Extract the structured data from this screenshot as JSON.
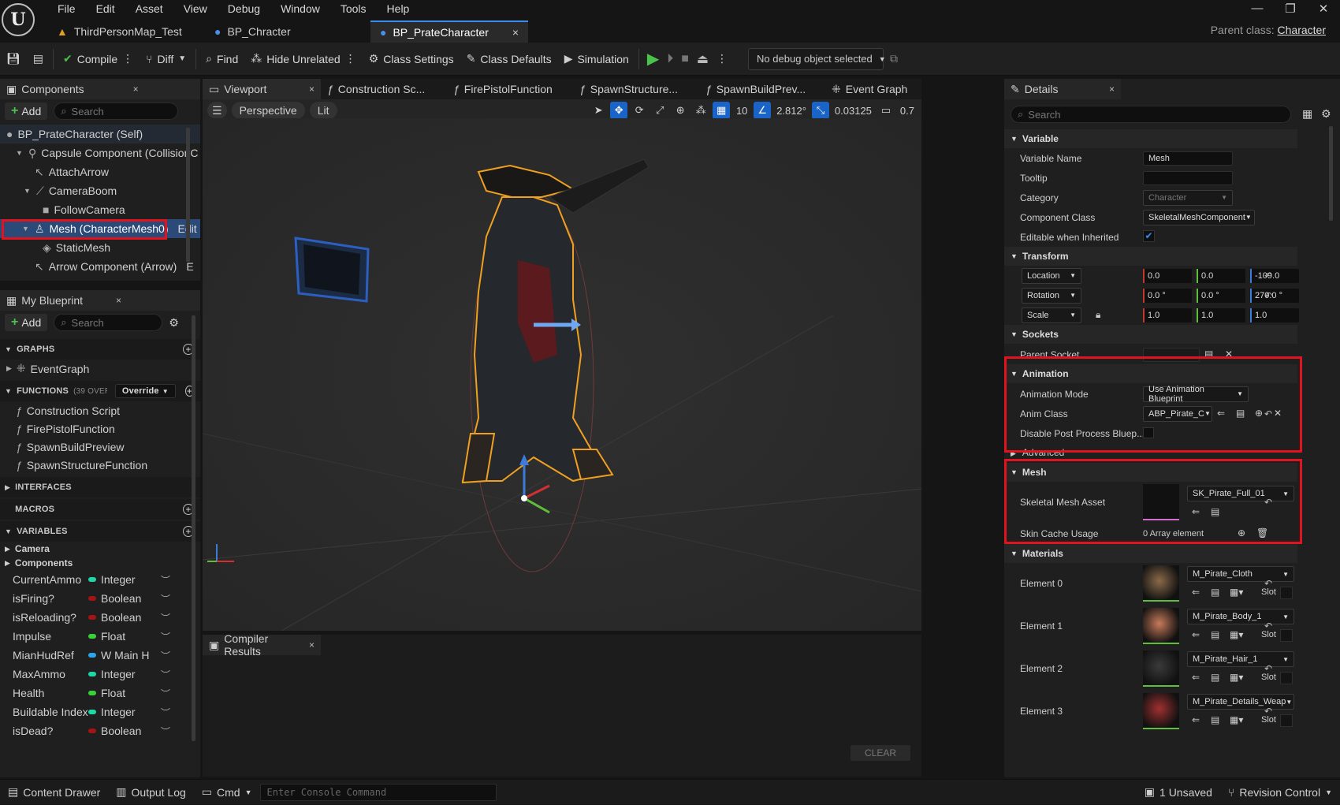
{
  "menu": [
    "File",
    "Edit",
    "Asset",
    "View",
    "Debug",
    "Window",
    "Tools",
    "Help"
  ],
  "window_controls": {
    "minimize": "—",
    "restore": "❐",
    "close": "✕"
  },
  "doc_tabs": [
    {
      "label": "ThirdPersonMap_Test",
      "icon": "map-icon"
    },
    {
      "label": "BP_Chracter",
      "icon": "person-icon"
    },
    {
      "label": "BP_PrateCharacter",
      "icon": "person-icon",
      "close": "×"
    }
  ],
  "parent_class": {
    "label": "Parent class:",
    "value": "Character"
  },
  "toolbar": {
    "compile": "Compile",
    "diff": "Diff",
    "find": "Find",
    "hide_unrelated": "Hide Unrelated",
    "class_settings": "Class Settings",
    "class_defaults": "Class Defaults",
    "simulation": "Simulation",
    "debug_object": "No debug object selected"
  },
  "components": {
    "tab": "Components",
    "add": "Add",
    "search_placeholder": "Search",
    "items": [
      {
        "label": "BP_PrateCharacter (Self)"
      },
      {
        "label": "Capsule Component (CollisionC"
      },
      {
        "label": "AttachArrow"
      },
      {
        "label": "CameraBoom"
      },
      {
        "label": "FollowCamera"
      },
      {
        "label": "Mesh (CharacterMesh0)",
        "suffix": "Edit"
      },
      {
        "label": "StaticMesh"
      },
      {
        "label": "Arrow Component (Arrow)",
        "suffix": "E"
      }
    ]
  },
  "my_blueprint": {
    "tab": "My Blueprint",
    "add": "Add",
    "search_placeholder": "Search",
    "graphs_header": "GRAPHS",
    "graphs": [
      "EventGraph"
    ],
    "functions_header": "FUNCTIONS",
    "functions_count": "(39 OVERRI",
    "override": "Override",
    "functions": [
      "Construction Script",
      "FirePistolFunction",
      "SpawnBuildPreview",
      "SpawnStructureFunction"
    ],
    "interfaces_header": "INTERFACES",
    "macros_header": "MACROS",
    "variables_header": "VARIABLES",
    "var_groups": [
      "Camera",
      "Components"
    ],
    "variables": [
      {
        "name": "CurrentAmmo",
        "type": "Integer",
        "color": "#1fd6a6"
      },
      {
        "name": "isFiring?",
        "type": "Boolean",
        "color": "#a31414"
      },
      {
        "name": "isReloading?",
        "type": "Boolean",
        "color": "#a31414"
      },
      {
        "name": "Impulse",
        "type": "Float",
        "color": "#38d13a"
      },
      {
        "name": "MianHudRef",
        "type": "W Main H",
        "color": "#2aa6e8"
      },
      {
        "name": "MaxAmmo",
        "type": "Integer",
        "color": "#1fd6a6"
      },
      {
        "name": "Health",
        "type": "Float",
        "color": "#38d13a"
      },
      {
        "name": "Buildable Index",
        "type": "Integer",
        "color": "#1fd6a6"
      },
      {
        "name": "isDead?",
        "type": "Boolean",
        "color": "#a31414"
      }
    ]
  },
  "editor_tabs": [
    {
      "label": "Viewport",
      "close": "×"
    },
    {
      "label": "Construction Sc..."
    },
    {
      "label": "FirePistolFunction"
    },
    {
      "label": "SpawnStructure..."
    },
    {
      "label": "SpawnBuildPrev..."
    },
    {
      "label": "Event Graph"
    }
  ],
  "viewport": {
    "perspective": "Perspective",
    "lit": "Lit",
    "grid_snap": "10",
    "rot_snap": "2.812°",
    "scale_snap": "0.03125",
    "cam_speed": "0.7"
  },
  "compiler": {
    "tab": "Compiler Results",
    "clear": "CLEAR"
  },
  "details": {
    "tab": "Details",
    "search_placeholder": "Search",
    "variable": {
      "header": "Variable",
      "variable_name_label": "Variable Name",
      "variable_name": "Mesh",
      "tooltip_label": "Tooltip",
      "category_label": "Category",
      "category": "Character",
      "component_class_label": "Component Class",
      "component_class": "SkeletalMeshComponent",
      "editable_label": "Editable when Inherited"
    },
    "transform": {
      "header": "Transform",
      "location_label": "Location",
      "location": [
        "0.0",
        "0.0",
        "-109.0"
      ],
      "rotation_label": "Rotation",
      "rotation": [
        "0.0 °",
        "0.0 °",
        "270.0 °"
      ],
      "scale_label": "Scale",
      "scale": [
        "1.0",
        "1.0",
        "1.0"
      ]
    },
    "sockets": {
      "header": "Sockets",
      "parent_socket_label": "Parent Socket"
    },
    "animation": {
      "header": "Animation",
      "mode_label": "Animation Mode",
      "mode": "Use Animation Blueprint",
      "class_label": "Anim Class",
      "class": "ABP_Pirate_C",
      "disable_label": "Disable Post Process Bluep...",
      "advanced": "Advanced"
    },
    "mesh": {
      "header": "Mesh",
      "asset_label": "Skeletal Mesh Asset",
      "asset": "SK_Pirate_Full_01",
      "skin_label": "Skin Cache Usage",
      "skin": "0 Array element"
    },
    "materials": {
      "header": "Materials",
      "slot": "Slot",
      "elements": [
        {
          "label": "Element 0",
          "value": "M_Pirate_Cloth"
        },
        {
          "label": "Element 1",
          "value": "M_Pirate_Body_1"
        },
        {
          "label": "Element 2",
          "value": "M_Pirate_Hair_1"
        },
        {
          "label": "Element 3",
          "value": "M_Pirate_Details_Weap"
        }
      ]
    }
  },
  "statusbar": {
    "content_drawer": "Content Drawer",
    "output_log": "Output Log",
    "cmd": "Cmd",
    "console_placeholder": "Enter Console Command",
    "unsaved": "1 Unsaved",
    "revision": "Revision Control"
  },
  "colors": {
    "accent": "#1a64c8",
    "highlight": "#e0141e",
    "selection": "#2b4a78",
    "play": "#49c34a"
  }
}
